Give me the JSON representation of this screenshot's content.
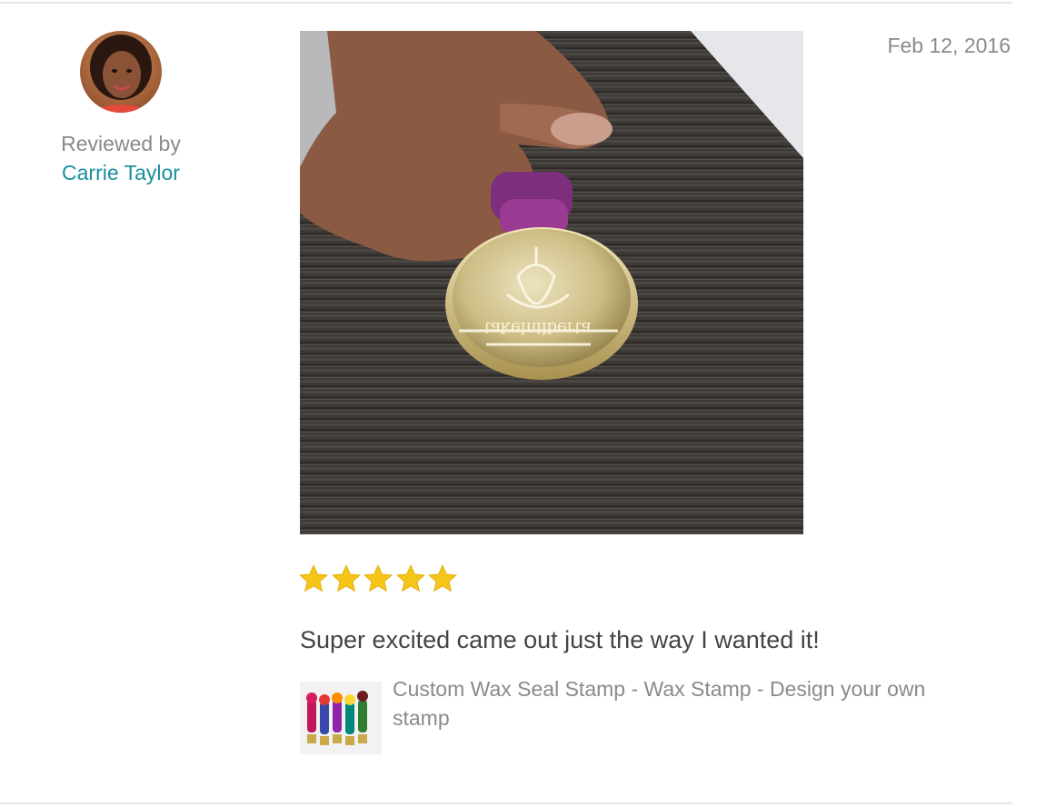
{
  "review": {
    "reviewed_by_label": "Reviewed by",
    "reviewer_name": "Carrie Taylor",
    "date": "Feb 12, 2016",
    "rating": 5,
    "rating_max": 5,
    "text": "Super excited came out just the way I wanted it!"
  },
  "listing": {
    "title": "Custom Wax Seal Stamp - Wax Stamp - Design your own stamp"
  },
  "colors": {
    "reviewer_link": "#1a8e9e",
    "star": "#f5c518",
    "muted_text": "#8a8a8a",
    "body_text": "#444444"
  },
  "icons": {
    "star": "star-icon"
  }
}
